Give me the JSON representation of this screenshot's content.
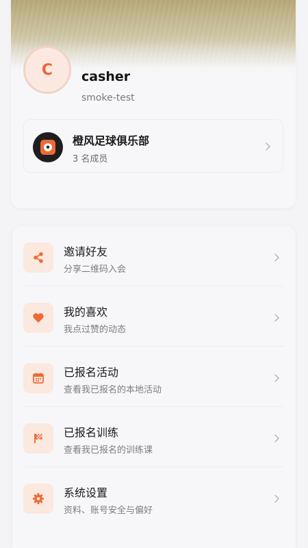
{
  "profile": {
    "avatar_initial": "C",
    "username": "casher",
    "subtitle": "smoke-test"
  },
  "club": {
    "name": "橙风足球俱乐部",
    "members": "3 名成员"
  },
  "menu": {
    "items": [
      {
        "title": "邀请好友",
        "desc": "分享二维码入会",
        "icon": "share-icon"
      },
      {
        "title": "我的喜欢",
        "desc": "我点过赞的动态",
        "icon": "heart-icon"
      },
      {
        "title": "已报名活动",
        "desc": "查看我已报名的本地活动",
        "icon": "calendar-icon"
      },
      {
        "title": "已报名训练",
        "desc": "查看我已报名的训练课",
        "icon": "flag-icon"
      },
      {
        "title": "系统设置",
        "desc": "资料、账号安全与偏好",
        "icon": "gear-icon"
      }
    ]
  },
  "colors": {
    "accent": "#ee6a34",
    "icon_bg": "#fbe8df",
    "card_bg": "#f7f7f9",
    "page_bg": "#f4f4f6"
  }
}
